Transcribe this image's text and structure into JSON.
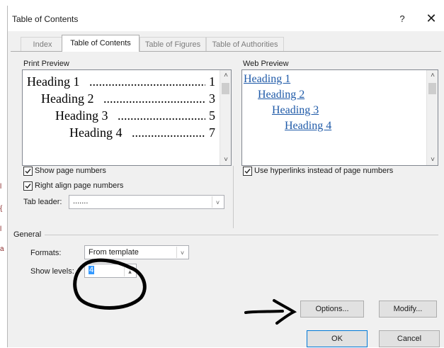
{
  "dialog": {
    "title": "Table of Contents",
    "help_label": "?",
    "close_label": "✕"
  },
  "tabs": [
    {
      "label": "Index",
      "active": false
    },
    {
      "label": "Table of Contents",
      "active": true
    },
    {
      "label": "Table of Figures",
      "active": false
    },
    {
      "label": "Table of Authorities",
      "active": false
    }
  ],
  "print_preview": {
    "label": "Print Preview",
    "lines": [
      {
        "text": "Heading 1",
        "dots": "........................................................",
        "page": "1"
      },
      {
        "text": "Heading 2",
        "dots": "........................................................",
        "page": "3"
      },
      {
        "text": "Heading 3",
        "dots": "........................................................",
        "page": "5"
      },
      {
        "text": "Heading 4",
        "dots": "........................................................",
        "page": "7"
      }
    ]
  },
  "web_preview": {
    "label": "Web Preview",
    "lines": [
      "Heading 1",
      "Heading 2",
      "Heading 3",
      "Heading 4"
    ]
  },
  "options": {
    "show_page_numbers": {
      "label": "Show page numbers",
      "checked": true
    },
    "right_align": {
      "label": "Right align page numbers",
      "checked": true
    },
    "use_hyperlinks": {
      "label": "Use hyperlinks instead of page numbers",
      "checked": true
    },
    "tab_leader": {
      "label": "Tab leader:",
      "value": "......."
    }
  },
  "general": {
    "label": "General",
    "formats": {
      "label": "Formats:",
      "value": "From template"
    },
    "show_levels": {
      "label": "Show levels:",
      "value": "4"
    }
  },
  "buttons": {
    "options": "Options...",
    "modify": "Modify...",
    "ok": "OK",
    "cancel": "Cancel"
  },
  "left_margin_marks": [
    "l",
    "{",
    "l",
    "a"
  ],
  "colors": {
    "hyperlink": "#1f5aa8",
    "annotation": "#000000",
    "default_button_border": "#0078d7"
  }
}
